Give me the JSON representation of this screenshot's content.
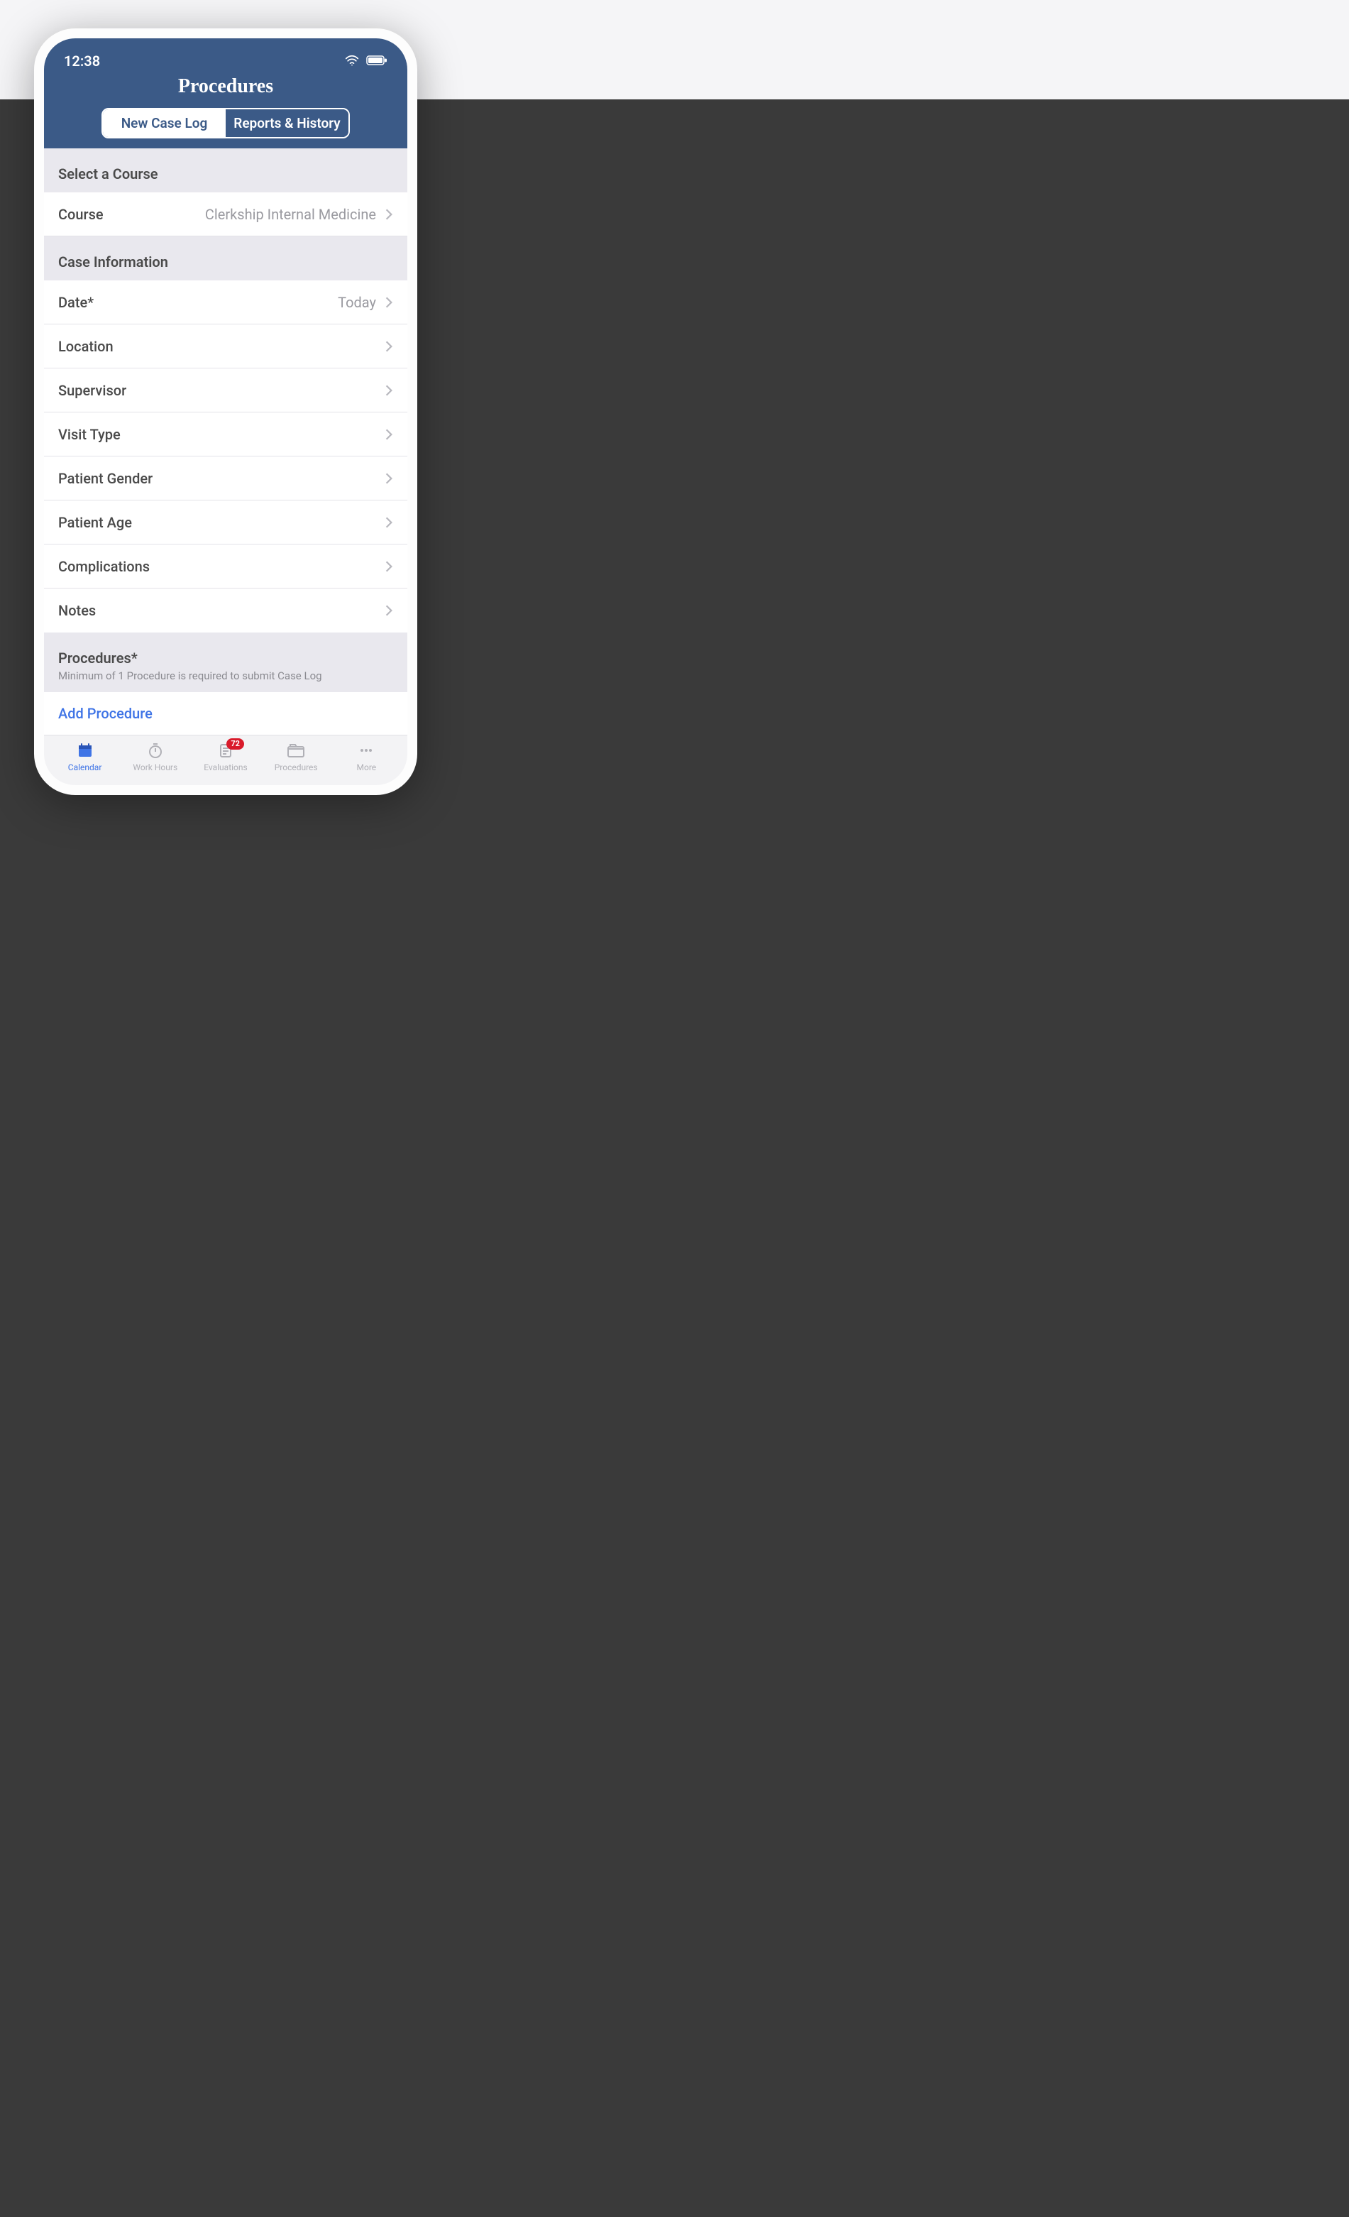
{
  "status": {
    "time": "12:38"
  },
  "header": {
    "title": "Procedures",
    "seg_active": "New Case Log",
    "seg_inactive": "Reports & History"
  },
  "course_section": {
    "header": "Select a Course",
    "row_label": "Course",
    "row_value": "Clerkship Internal Medicine"
  },
  "case_section": {
    "header": "Case Information",
    "rows": [
      {
        "label": "Date*",
        "value": "Today"
      },
      {
        "label": "Location",
        "value": ""
      },
      {
        "label": "Supervisor",
        "value": ""
      },
      {
        "label": "Visit Type",
        "value": ""
      },
      {
        "label": "Patient Gender",
        "value": ""
      },
      {
        "label": "Patient Age",
        "value": ""
      },
      {
        "label": "Complications",
        "value": ""
      },
      {
        "label": "Notes",
        "value": ""
      }
    ]
  },
  "proc_section": {
    "header": "Procedures*",
    "sub": "Minimum of 1 Procedure is required to submit Case Log",
    "add_label": "Add Procedure"
  },
  "tabs": {
    "calendar": "Calendar",
    "workhours": "Work Hours",
    "evaluations": "Evaluations",
    "evaluations_badge": "72",
    "procedures": "Procedures",
    "more": "More"
  }
}
